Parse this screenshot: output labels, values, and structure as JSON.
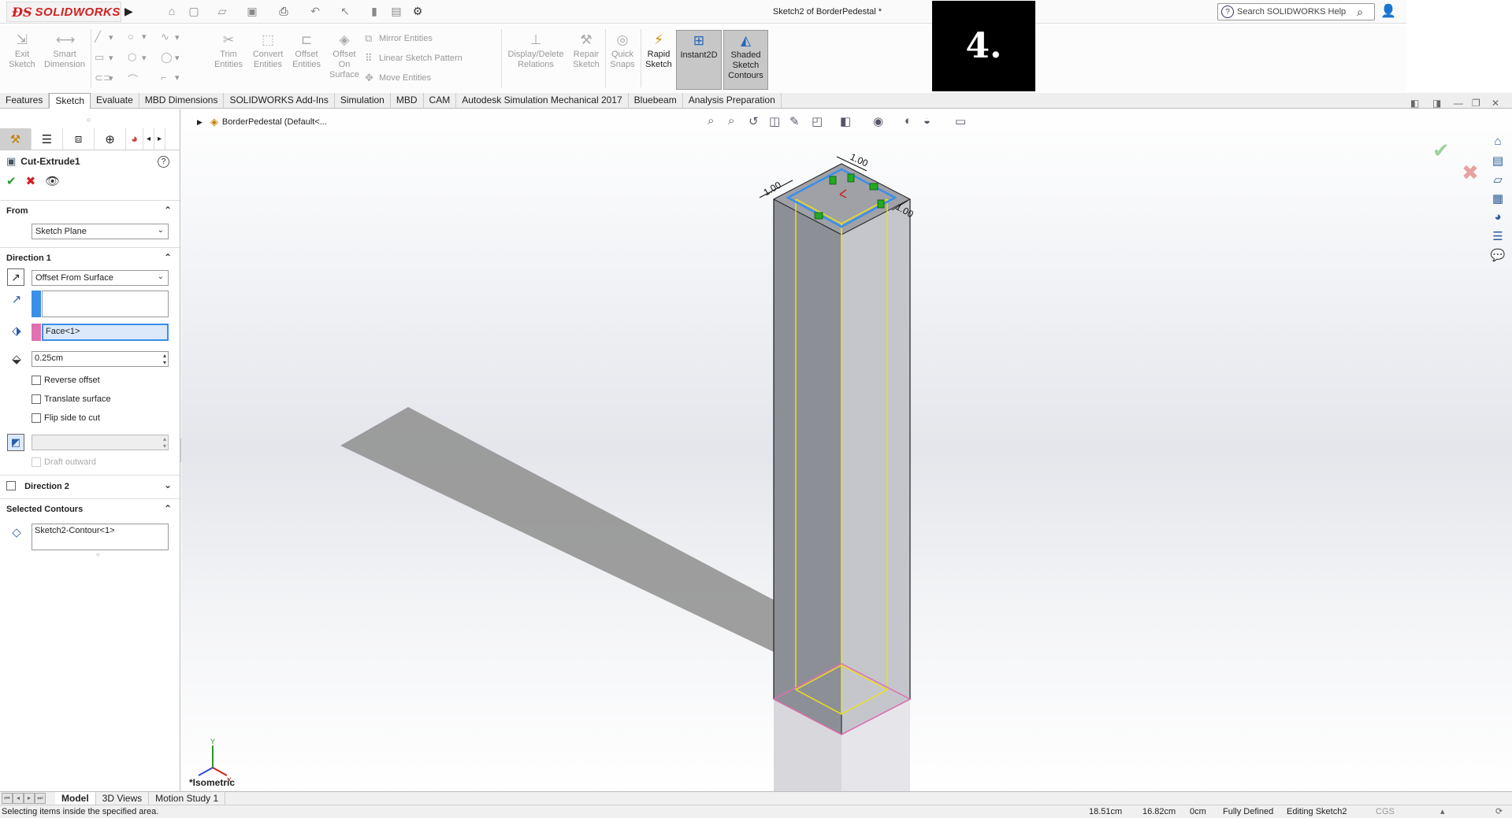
{
  "app": {
    "logo_text": "SOLIDWORKS",
    "document_title": "Sketch2 of BorderPedestal *",
    "search_placeholder": "Search SOLIDWORKS Help",
    "overlay_badge": "4."
  },
  "ribbon": {
    "exit_sketch": "Exit Sketch",
    "smart_dimension": "Smart Dimension",
    "trim_entities": "Trim Entities",
    "convert_entities": "Convert Entities",
    "offset_entities": "Offset Entities",
    "offset_on_surface": "Offset On Surface",
    "mirror_entities": "Mirror Entities",
    "linear_sketch_pattern": "Linear Sketch Pattern",
    "move_entities": "Move Entities",
    "display_delete_relations": "Display/Delete Relations",
    "repair_sketch": "Repair Sketch",
    "quick_snaps": "Quick Snaps",
    "rapid_sketch": "Rapid Sketch",
    "instant2d": "Instant2D",
    "shaded_sketch_contours": "Shaded Sketch Contours"
  },
  "tabs": [
    "Features",
    "Sketch",
    "Evaluate",
    "MBD Dimensions",
    "SOLIDWORKS Add-Ins",
    "Simulation",
    "MBD",
    "CAM",
    "Autodesk Simulation Mechanical 2017",
    "Bluebeam",
    "Analysis Preparation"
  ],
  "active_tab": "Sketch",
  "property_manager": {
    "title": "Cut-Extrude1",
    "from_label": "From",
    "from_value": "Sketch Plane",
    "direction1_label": "Direction 1",
    "end_condition": "Offset From Surface",
    "face_value": "Face<1>",
    "offset_value": "0.25cm",
    "reverse_offset": "Reverse offset",
    "translate_surface": "Translate surface",
    "flip_side": "Flip side to cut",
    "draft_outward": "Draft outward",
    "direction2_label": "Direction 2",
    "selected_contours_label": "Selected Contours",
    "selected_contours_value": "Sketch2-Contour<1>"
  },
  "viewport": {
    "tree_root": "BorderPedestal  (Default<...",
    "view_orientation": "*Isometric",
    "dims": [
      "1.00",
      "1.00",
      "1.00"
    ]
  },
  "bottom_tabs": [
    "Model",
    "3D Views",
    "Motion Study 1"
  ],
  "active_bottom_tab": "Model",
  "status": {
    "message": "Selecting items inside the specified area.",
    "x": "18.51cm",
    "y": "16.82cm",
    "z": "0cm",
    "defined": "Fully Defined",
    "editing": "Editing Sketch2",
    "units": "CGS"
  },
  "colors": {
    "accent": "#2266bb",
    "brand": "#d02020",
    "sketch_yellow": "#e8e020",
    "sketch_blue": "#3a8fe8",
    "plane_pink": "#e070b0"
  }
}
